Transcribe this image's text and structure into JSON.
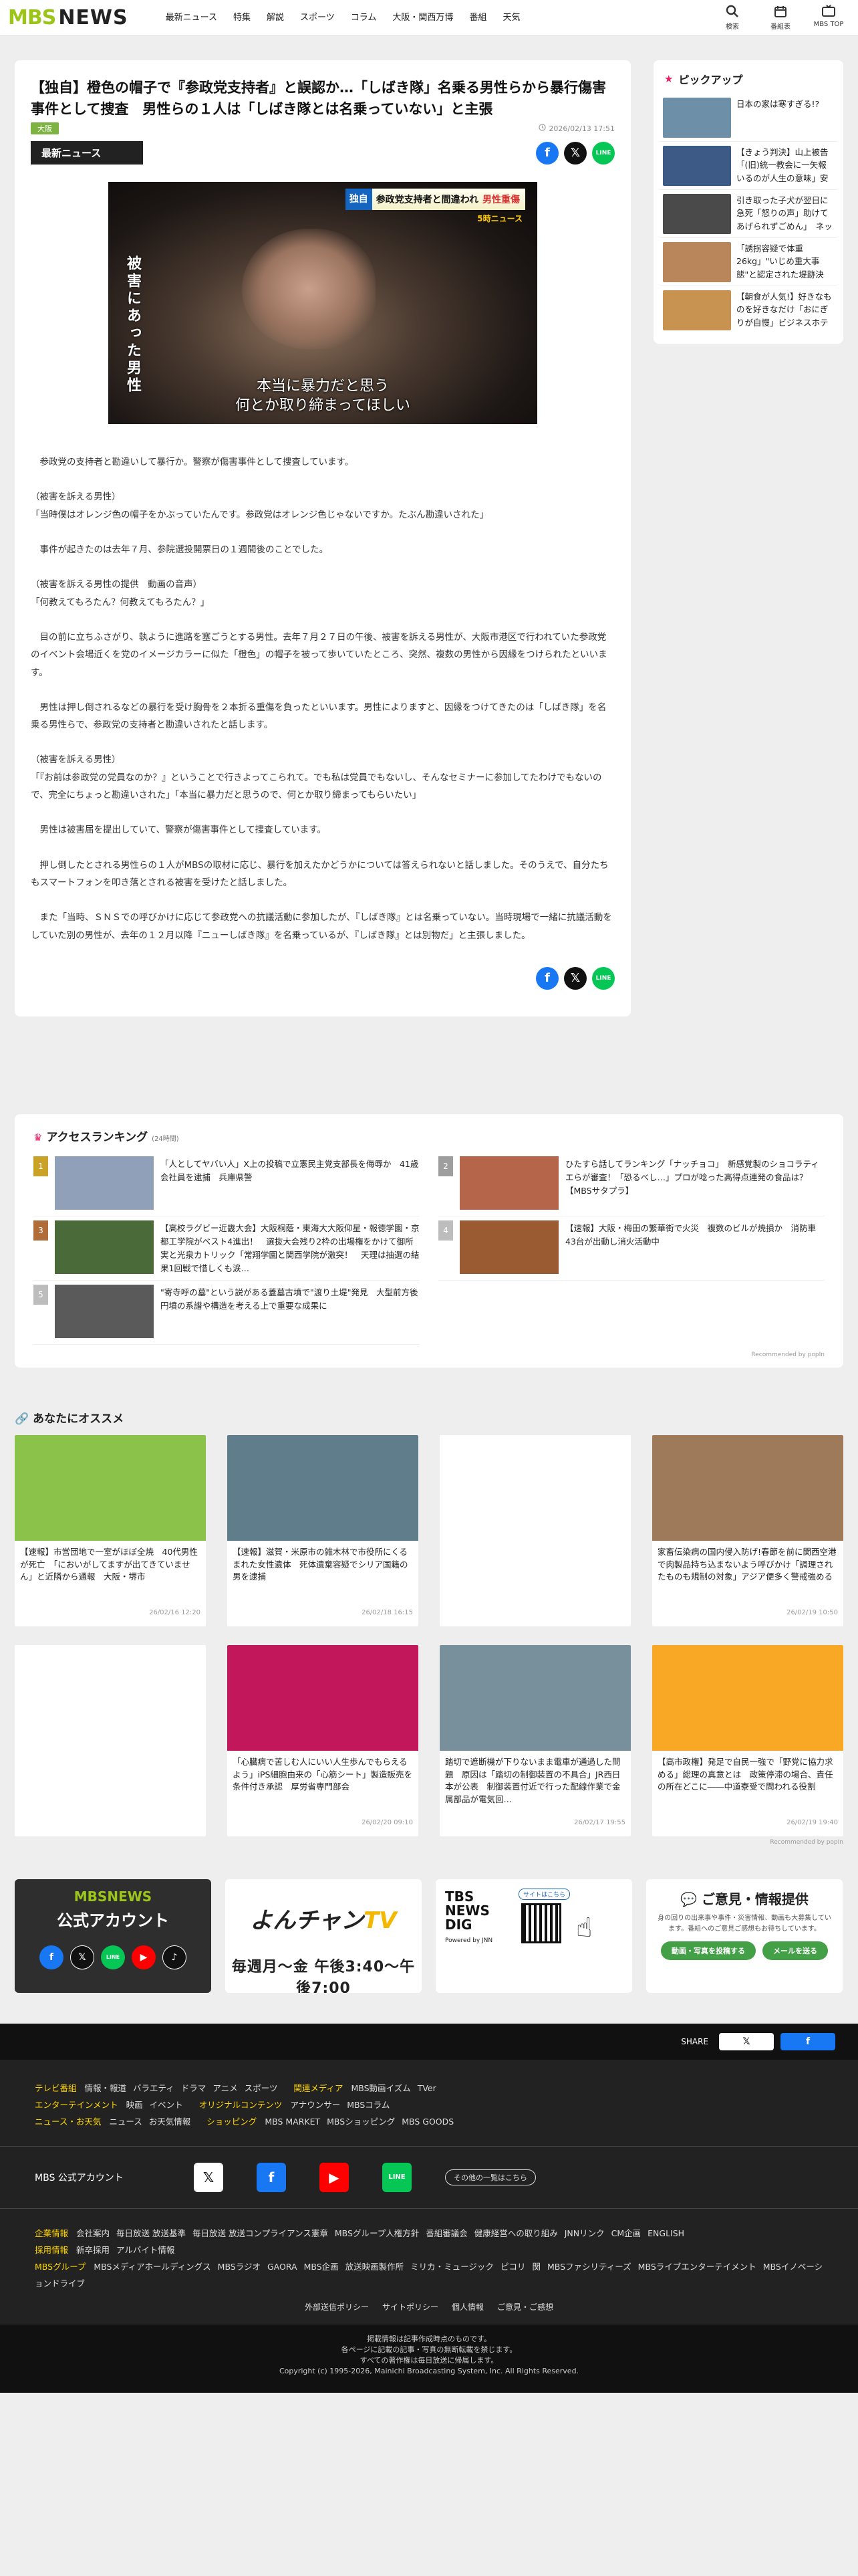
{
  "header": {
    "logo_mbs": "MBS",
    "logo_news": "NEWS",
    "nav": [
      "最新ニュース",
      "特集",
      "解説",
      "スポーツ",
      "コラム",
      "大阪・関西万博",
      "番組",
      "天気"
    ],
    "icons": [
      {
        "name": "search-icon",
        "label": "検索"
      },
      {
        "name": "calendar-icon",
        "label": "番組表"
      },
      {
        "name": "tv-icon",
        "label": "MBS TOP"
      }
    ]
  },
  "article": {
    "title": "【独自】橙色の帽子で『参政党支持者』と誤認か…「しばき隊」名乗る男性らから暴行傷害事件として捜査　男性らの１人は「しばき隊とは名乗っていない」と主張",
    "tag": "大阪",
    "date": "2026/02/13 17:51",
    "category": "最新ニュース",
    "photo": {
      "badge_label": "独自",
      "badge_text": "参政党支持者と間違われ",
      "badge_red": "男性重傷",
      "program": "5時ニュース",
      "vertical": "被害にあった男性",
      "caption_1": "本当に暴力だと思う",
      "caption_2": "何とか取り締まってほしい"
    },
    "paragraphs": [
      {
        "indent": true,
        "text": "参政党の支持者と勘違いして暴行か。警察が傷害事件として捜査しています。"
      },
      {
        "indent": false,
        "text": "（被害を訴える男性）\n「当時僕はオレンジ色の帽子をかぶっていたんです。参政党はオレンジ色じゃないですか。たぶん勘違いされた」"
      },
      {
        "indent": true,
        "text": "事件が起きたのは去年７月、参院選投開票日の１週間後のことでした。"
      },
      {
        "indent": false,
        "text": "（被害を訴える男性の提供　動画の音声）\n「何教えてもろたん？何教えてもろたん？」"
      },
      {
        "indent": true,
        "text": "目の前に立ちふさがり、執ように進路を塞ごうとする男性。去年７月２７日の午後、被害を訴える男性が、大阪市港区で行われていた参政党のイベント会場近くを党のイメージカラーに似た「橙色」の帽子を被って歩いていたところ、突然、複数の男性から因縁をつけられたといいます。"
      },
      {
        "indent": true,
        "text": "男性は押し倒されるなどの暴行を受け胸骨を２本折る重傷を負ったといいます。男性によりますと、因縁をつけてきたのは「しばき隊」を名乗る男性らで、参政党の支持者と勘違いされたと話します。"
      },
      {
        "indent": false,
        "text": "（被害を訴える男性）\n「『お前は参政党の党員なのか？』ということで行きよってこられて。でも私は党員でもないし、そんなセミナーに参加してたわけでもないので、完全にちょっと勘違いされた」「本当に暴力だと思うので、何とか取り締まってもらいたい」"
      },
      {
        "indent": true,
        "text": "男性は被害届を提出していて、警察が傷害事件として捜査しています。"
      },
      {
        "indent": true,
        "text": "押し倒したとされる男性らの１人がMBSの取材に応じ、暴行を加えたかどうかについては答えられないと話しました。そのうえで、自分たちもスマートフォンを叩き落とされる被害を受けたと話しました。"
      },
      {
        "indent": true,
        "text": "また「当時、ＳＮＳでの呼びかけに応じて参政党への抗議活動に参加したが、『しばき隊』とは名乗っていない。当時現場で一緒に抗議活動をしていた別の男性が、去年の１２月以降『ニューしばき隊』を名乗っているが、『しばき隊』とは別物だ」と主張しました。"
      }
    ]
  },
  "sidebar": {
    "title": "ピックアップ",
    "items": [
      {
        "text": "日本の家は寒すぎる!?",
        "color": "#6d8fa8"
      },
      {
        "text": "【きょう判決】山上被告「(旧)統一教会に一矢報いるのが人生の意味」安倍元総理銃撃事件…",
        "color": "#3d5a86"
      },
      {
        "text": "引き取った子犬が翌日に急死「怒りの声」助けてあげられずごめん」　ネット譲渡めぐりトラブル…",
        "color": "#4a4a4a"
      },
      {
        "text": "「誘拐容疑で体重26kg」\"いじめ重大事態\"と認定された堤跡決意…いじめと闘った元同級生…",
        "color": "#b8865a"
      },
      {
        "text": "【朝食が人気!】好きなものを好きなだけ「おにぎりが自慢」ビジネスホテルなのに「宿泊客」以…",
        "color": "#c89250"
      }
    ]
  },
  "ranking": {
    "title": "アクセスランキング",
    "sub": "(24時間)",
    "items": [
      {
        "rank": "1",
        "rank_color": "#c9a227",
        "color": "#8fa0b8",
        "text": "「人としてヤバい人」X上の投稿で立憲民主党支部長を侮辱か　41歳会社員を逮捕　兵庫県警"
      },
      {
        "rank": "2",
        "rank_color": "#9e9e9e",
        "color": "#b5654a",
        "text": "ひたすら話してランキング「ナッチョコ」　新感覚製のショコラティエらが審査！「恐るべし…」プロが唸った高得点連発の食品は？【MBSサタプラ】"
      },
      {
        "rank": "3",
        "rank_color": "#b06d3a",
        "color": "#4b6a3a",
        "text": "【高校ラグビー近畿大会】大阪桐蔭・東海大大阪仰星・報徳学園・京都工学院がベスト4進出！　選抜大会残り2枠の出場権をかけて御所実と光泉カトリック「常翔学園と関西学院が激突！　天理は抽選の結果1回戦で惜しくも涙…"
      },
      {
        "rank": "4",
        "rank_color": "#bdbdbd",
        "color": "#9a5a32",
        "text": "【速報】大阪・梅田の繁華街で火災　複数のビルが焼損か　消防車43台が出動し消火活動中"
      },
      {
        "rank": "5",
        "rank_color": "#bdbdbd",
        "color": "#5a5a5a",
        "text": "\"寄寺呼の墓\"という説がある蓋墓古墳で\"渡り土堤\"発見　大型前方後円墳の系譜や構造を考える上で重要な成果に"
      }
    ],
    "reco": "Recommended by popIn"
  },
  "recommend": {
    "title": "あなたにオススメ",
    "cards": [
      {
        "color": "#8bc34a",
        "text": "【速報】市営団地で一室がほぼ全焼　40代男性が死亡　「においがしてますが出てきていません」と近隣から通報　大阪・堺市",
        "date": "26/02/16 12:20"
      },
      {
        "color": "#607d8b",
        "text": "【速報】滋賀・米原市の雑木林で市役所にくるまれた女性遺体　死体遺棄容疑でシリア国籍の男を逮捕",
        "date": "26/02/18 16:15"
      },
      {
        "color": "#ffffff",
        "text": "",
        "date": ""
      },
      {
        "color": "#9e7a5a",
        "text": "家畜伝染病の国内侵入防げ!春節を前に関西空港で肉製品持ち込まないよう呼びかけ「調理されたものも規制の対象」アジア便多く警戒強める",
        "date": "26/02/19 10:50"
      },
      {
        "color": "#ffffff",
        "text": "",
        "date": ""
      },
      {
        "color": "#c2185b",
        "text": "「心臓病で苦しむ人にいい人生歩んでもらえるよう」iPS細胞由来の「心筋シート」製造販売を条件付き承認　厚労省専門部会",
        "date": "26/02/20 09:10"
      },
      {
        "color": "#78909c",
        "text": "踏切で遮断機が下りないまま電車が通過した問題　原因は「踏切の制御装置の不具合」JR西日本が公表　制御装置付近で行った配線作業で金属部品が電気回…",
        "date": "26/02/17 19:55"
      },
      {
        "color": "#f9a825",
        "text": "【高市政権】発足で自民一強で「野党に協力求める」総理の真意とは　政策停滞の場合、責任の所在どこに――中道寮受で問われる役割",
        "date": "26/02/19 19:40"
      }
    ],
    "reco": "Recommended by popIn"
  },
  "banners": {
    "official_line1": "MBSNEWS",
    "official_line2": "公式アカウント",
    "yonchan_logo_a": "よんチャン",
    "yonchan_logo_b": "TV",
    "yonchan_time": "毎週月～金 午後3:40〜午後7:00",
    "tbs": "TBS NEWS DIG",
    "tbs_site": "サイトはこちら",
    "tbs_powered": "Powered by JNN",
    "feedback_title": "ご意見・情報提供",
    "feedback_desc": "身の回りの出来事や事件・災害情報、動画も大募集しています。番組へのご意見ご感想もお待ちしています。",
    "feedback_btn1": "動画・写真を投稿する",
    "feedback_btn2": "メールを送る"
  },
  "footer": {
    "share_label": "SHARE",
    "rows": [
      {
        "head": "テレビ番組",
        "links": [
          "情報・報道",
          "バラエティ",
          "ドラマ",
          "アニメ",
          "スポーツ"
        ],
        "head2": "関連メディア",
        "links2": [
          "MBS動画イズム",
          "TVer"
        ]
      },
      {
        "head": "エンターテインメント",
        "links": [
          "映画",
          "イベント"
        ],
        "head2": "オリジナルコンテンツ",
        "links2": [
          "アナウンサー",
          "MBSコラム"
        ]
      },
      {
        "head": "ニュース・お天気",
        "links": [
          "ニュース",
          "お天気情報"
        ],
        "head2": "ショッピング",
        "links2": [
          "MBS MARKET",
          "MBSショッピング",
          "MBS GOODS"
        ]
      }
    ],
    "social_title": "MBS 公式アカウント",
    "social_more": "その他の一覧はこちら",
    "company": [
      {
        "head": "企業情報",
        "links": [
          "会社案内",
          "毎日放送 放送基準",
          "毎日放送 放送コンプライアンス憲章",
          "MBSグループ人権方針",
          "番組審議会",
          "健康経営への取り組み",
          "JNNリンク",
          "CM企画",
          "ENGLISH"
        ]
      },
      {
        "head": "採用情報",
        "links": [
          "新卒採用",
          "アルバイト情報"
        ]
      },
      {
        "head": "MBSグループ",
        "links": [
          "MBSメディアホールディングス",
          "MBSラジオ",
          "GAORA",
          "MBS企画",
          "放送映画製作所",
          "ミリカ・ミュージック",
          "ピコリ",
          "関",
          "MBSファシリティーズ",
          "MBSライブエンターテイメント",
          "MBSイノベーションドライブ"
        ]
      }
    ],
    "policy": [
      "外部送信ポリシー",
      "サイトポリシー",
      "個人情報",
      "ご意見・ご感想"
    ],
    "copy1": "掲載情報は記事作成時点のものです。",
    "copy2": "各ページに記載の記事・写真の無断転載を禁じます。",
    "copy3": "すべての著作権は毎日放送に帰属します。",
    "copy4": "Copyright (c) 1995-2026, Mainichi Broadcasting System, Inc. All Rights Reserved."
  }
}
